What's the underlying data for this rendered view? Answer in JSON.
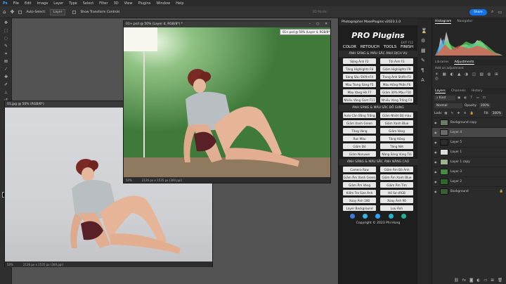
{
  "menu": [
    "File",
    "Edit",
    "Image",
    "Layer",
    "Type",
    "Select",
    "Filter",
    "3D",
    "View",
    "Plugins",
    "Window",
    "Help"
  ],
  "options": {
    "auto_select": "Auto-Select:",
    "layer_select": "Layer",
    "transform": "Show Transform Controls",
    "mode3d": "3D Mode:",
    "share": "Share"
  },
  "doc_front": {
    "title": "01+.psd @ 50% (Layer 4, RGB/8*) *",
    "zoom": "50%",
    "info": "2126 px x 1535 px (300 ppi)",
    "tooltip": "01+.psd @ 50% (Layer 4, RGB/8*) *"
  },
  "doc_back": {
    "title": "01.jpg @ 50% (RGB/8*)",
    "zoom": "50%",
    "info": "2126 px x 1535 px (300 ppi)"
  },
  "plugin": {
    "header": "Photographer MasePlugins v2023.1.0",
    "logo": "PRO Plugins",
    "exit": "EXIT F12",
    "tabs": [
      "COLOR",
      "RETOUCH",
      "TOOLS",
      "FINISH"
    ],
    "sec1": "ÁNH SÁNG & MÀU SẮC ẢNH DỊCH VỤ",
    "sec1_buttons": [
      "Sáng Ảnh F2",
      "Tối Ảnh F3",
      "Tăng Highlights F8",
      "Giảm Highlights F9",
      "Sáng Sâu Shift+F4",
      "Trong Ảnh Shift+F3",
      "Màu Trong Sáng F5",
      "Màu Hồng Phấn F6",
      "Màu Vàng Hè F7",
      "Giảm 30% Màu F10",
      "Nhiều Vàng Gam F11",
      "Nhiều Vàng Trắng F4"
    ],
    "sec2": "ÁNH SÁNG & MÀU SẮC BỔ SUNG",
    "sec2_buttons": [
      "Auto Cân Bằng Trắng",
      "Giảm Nhiệt Độ màu",
      "Giảm Xanh Green",
      "Giảm Xanh Blue",
      "Tăng Vàng",
      "Giảm Vàng",
      "Rực Màu",
      "Tăng Hồng",
      "Giảm Đỏ",
      "Tăng Nét",
      "Giảm Nonuwe",
      "Nâng Sáng Vùng Tối"
    ],
    "sec3": "ÁNH SÁNG & MÀU SẮC ẢNH NÂNG CAO",
    "sec3_buttons": [
      "Camera Raw",
      "Giảm Âm Đỏ Ảnh",
      "Giảm Âm Xanh Green",
      "Giảm Âm Xanh Blue",
      "Giảm Âm Vàng",
      "Giảm Âm Tím",
      "Kiểm Tra Size Ảnh",
      "Hồ Sơ sRGB",
      "Xoay Ảnh 180",
      "Xoay Ảnh 90",
      "Layer Background",
      "Lưu Ảnh"
    ],
    "copyright": "Copyright © 2023 Phi Hùng"
  },
  "panels": {
    "histogram_tabs": [
      "Histogram",
      "Navigator"
    ],
    "adj_tabs": [
      "Libraries",
      "Adjustments"
    ],
    "add_adjustment": "Add an adjustment",
    "layer_tabs": [
      "Layers",
      "Channels",
      "History"
    ],
    "kind": "Kind",
    "blend": "Normal",
    "opacity_label": "Opacity:",
    "opacity": "100%",
    "lock_label": "Lock:",
    "fill_label": "Fill:",
    "fill": "100%",
    "layers": [
      "Background copy",
      "Layer 4",
      "Layer 5",
      "Layer 1",
      "Layer 1 copy",
      "Layer 3",
      "Layer 2",
      "Background"
    ]
  }
}
